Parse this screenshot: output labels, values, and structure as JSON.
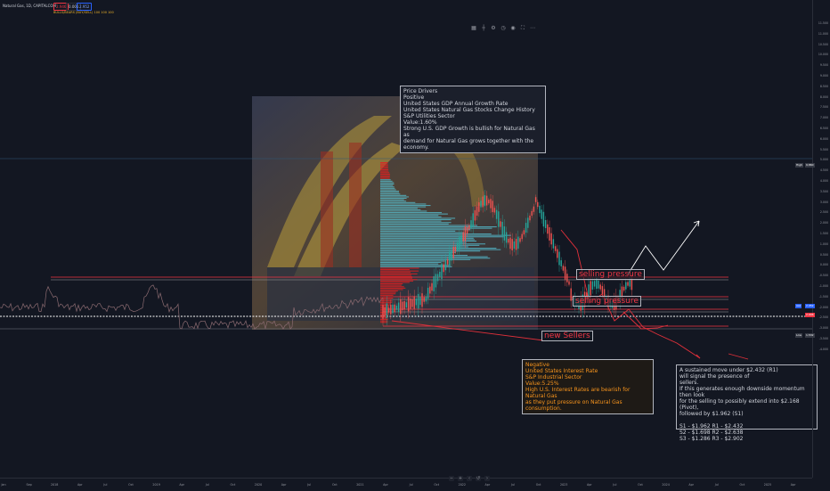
{
  "header": {
    "symbol": "Natural Gas, 1D, CAPITALCOM",
    "sell_price": "2.946",
    "spread": "0.006",
    "buy_price": "2.952",
    "indicator": "BULLS/BEARS (BUY/SELL) 100 100 100"
  },
  "toolbar": {
    "icons": [
      "bar-chart-icon",
      "crosshair-icon",
      "gear-icon",
      "clock-icon",
      "camera-icon",
      "fullscreen-icon",
      "ellipsis-icon"
    ],
    "glyphs": [
      "▦",
      "┼",
      "⚙",
      "◷",
      "◉",
      "⛶",
      "⋯"
    ]
  },
  "price_axis": {
    "ticks": [
      "11.500",
      "11.000",
      "10.500",
      "10.000",
      "9.500",
      "9.000",
      "8.500",
      "8.000",
      "7.500",
      "7.000",
      "6.500",
      "6.000",
      "5.500",
      "5.000",
      "4.500",
      "4.000",
      "3.500",
      "3.000",
      "2.500",
      "2.000",
      "1.500",
      "1.000",
      "0.500",
      "0.000",
      "-0.500",
      "-1.000",
      "-1.500",
      "-2.000",
      "-2.500",
      "-3.000",
      "-3.500",
      "-4.000"
    ],
    "high_tag": "High",
    "high_value": "9.860",
    "ask_tag": "Ask",
    "ask_value": "2.952",
    "bid_value": "2.946",
    "low_tag": "Low",
    "low_value": "1.532"
  },
  "time_axis": {
    "ticks": [
      "Jan",
      "Sep",
      "2018",
      "Apr",
      "Jul",
      "Oct",
      "2019",
      "Apr",
      "Jul",
      "Oct",
      "2020",
      "Apr",
      "Jul",
      "Oct",
      "2021",
      "Apr",
      "Jul",
      "Oct",
      "2022",
      "Apr",
      "Jul",
      "Oct",
      "2023",
      "Apr",
      "Jul",
      "Oct",
      "2024",
      "Apr",
      "Jul",
      "Oct",
      "2025",
      "Apr"
    ]
  },
  "annotations": {
    "drivers_positive": "Price Drivers\nPositive\nUnited States GDP Annual Growth Rate\nUnited States Natural Gas Stocks Change History\nS&P Utilities Sector\nValue:1.60%\nStrong U.S. GDP Growth is bullish for Natural Gas as\n demand for Natural Gas grows together with the economy.",
    "drivers_negative": "Negative\nUnited States Interest Rate\nS&P Industrial Sector\nValue:5.25%\nHigh U.S. Interest Rates are bearish for Natural Gas\nas they put pressure on Natural Gas consumption.",
    "scenario": "A sustained move under $2.432 (R1)\nwill signal the presence of\nsellers.\nIf this generates enough downside momentum then look\nfor the selling to possibly extend into $2.168 (Pivot),\n followed by $1.962 (S1)\n\nS1 - $1.962 R1 - $2.432\nS2 - $1.698 R2 - $2.638\nS3 - $1.286 R3 - $2.902",
    "selling_pressure_1": "selling pressure",
    "selling_pressure_2": "selling pressure",
    "new_sellers": "new Sellers"
  },
  "colors": {
    "background": "#131722",
    "resistance": "#f23645",
    "volume_profile": "#56c1d4",
    "volume_profile_high": "#e02020",
    "candles_up": "#26a69a",
    "candles_down": "#ef5350",
    "projection": "#ffffff",
    "bearish_path": "#e0303a"
  },
  "nav": {
    "icons": [
      "zoom-out-icon",
      "zoom-in-icon",
      "scroll-left-icon",
      "reset-icon",
      "scroll-right-icon"
    ],
    "glyphs": [
      "−",
      "+",
      "‹",
      "↺",
      "›"
    ]
  }
}
